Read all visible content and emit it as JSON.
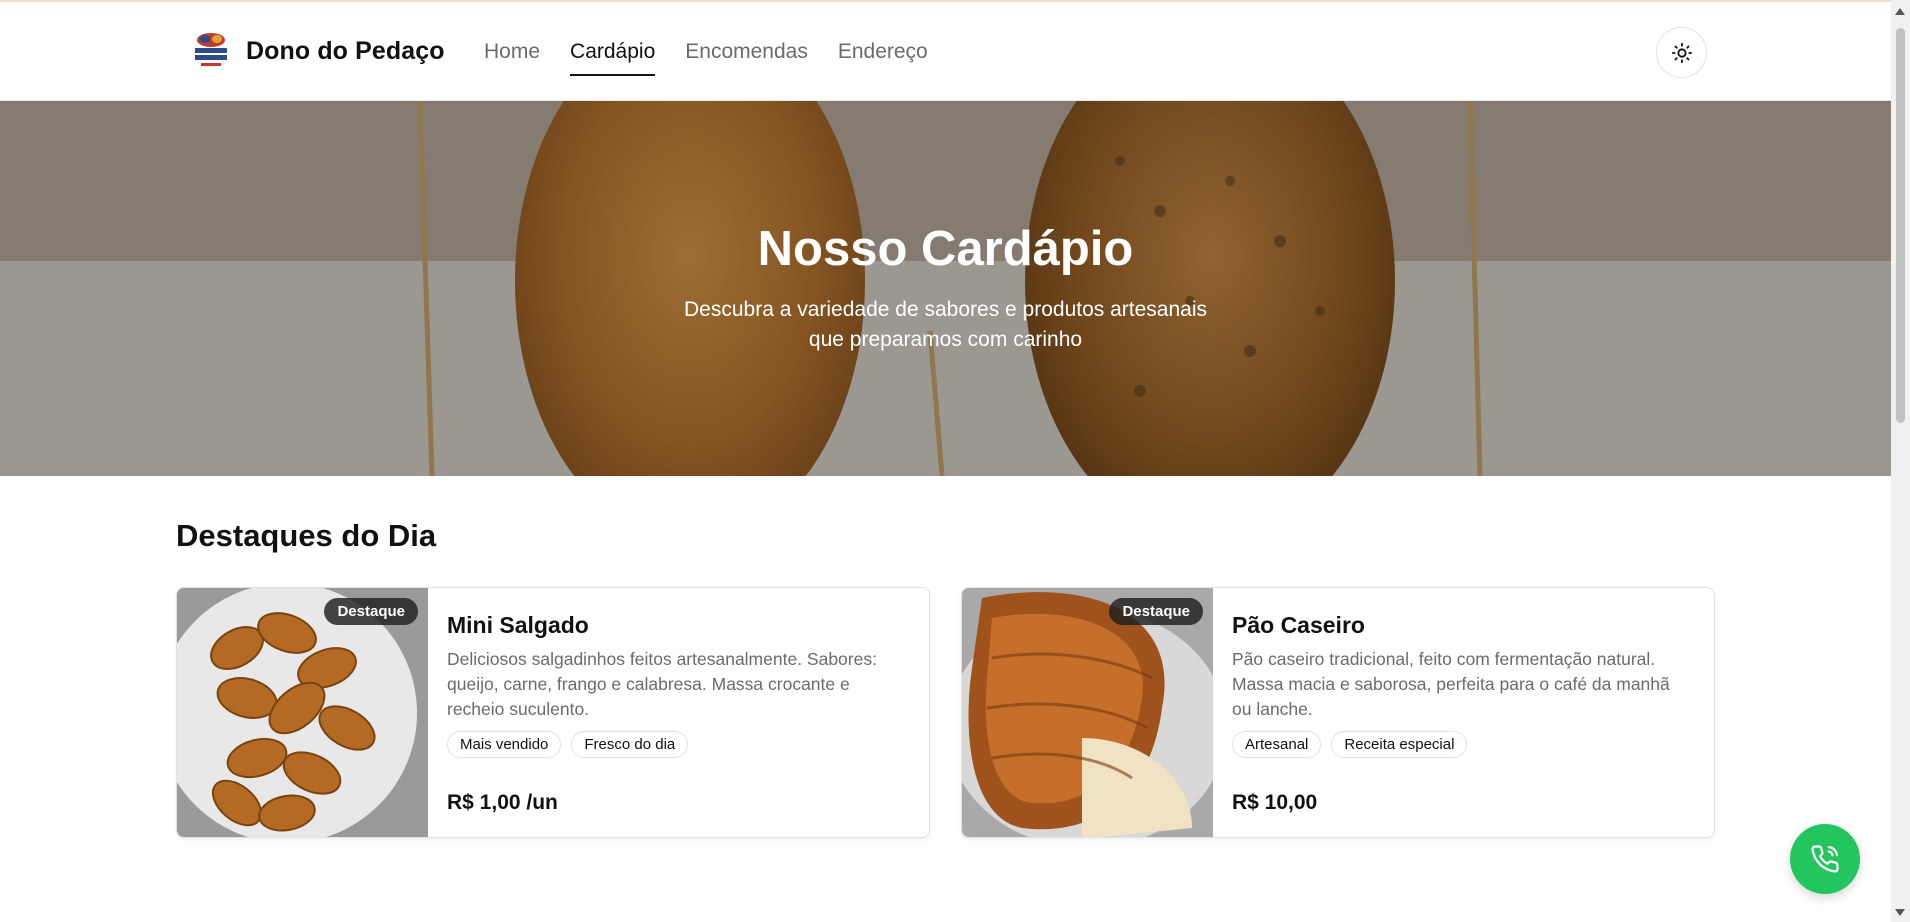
{
  "header": {
    "brand_name": "Dono do Pedaço",
    "logo_icon": "bakery-logo-icon",
    "nav": [
      {
        "label": "Home",
        "active": false
      },
      {
        "label": "Cardápio",
        "active": true
      },
      {
        "label": "Encomendas",
        "active": false
      },
      {
        "label": "Endereço",
        "active": false
      }
    ],
    "theme_toggle_icon": "sun-icon"
  },
  "hero": {
    "title": "Nosso Cardápio",
    "subtitle": "Descubra a variedade de sabores e produtos artesanais que preparamos com carinho"
  },
  "highlights": {
    "title": "Destaques do Dia",
    "cards": [
      {
        "badge": "Destaque",
        "name": "Mini Salgado",
        "description": "Deliciosos salgadinhos feitos artesanalmente. Sabores: queijo, carne, frango e calabresa. Massa crocante e recheio suculento.",
        "tags": [
          "Mais vendido",
          "Fresco do dia"
        ],
        "price": "R$ 1,00 /un"
      },
      {
        "badge": "Destaque",
        "name": "Pão Caseiro",
        "description": "Pão caseiro tradicional, feito com fermentação natural. Massa macia e saborosa, perfeita para o café da manhã ou lanche.",
        "tags": [
          "Artesanal",
          "Receita especial"
        ],
        "price": "R$ 10,00"
      }
    ]
  },
  "floating_button_icon": "phone-icon",
  "colors": {
    "accent_green": "#22c55e",
    "text_dark": "#111111",
    "text_muted": "#6b6b6b"
  }
}
